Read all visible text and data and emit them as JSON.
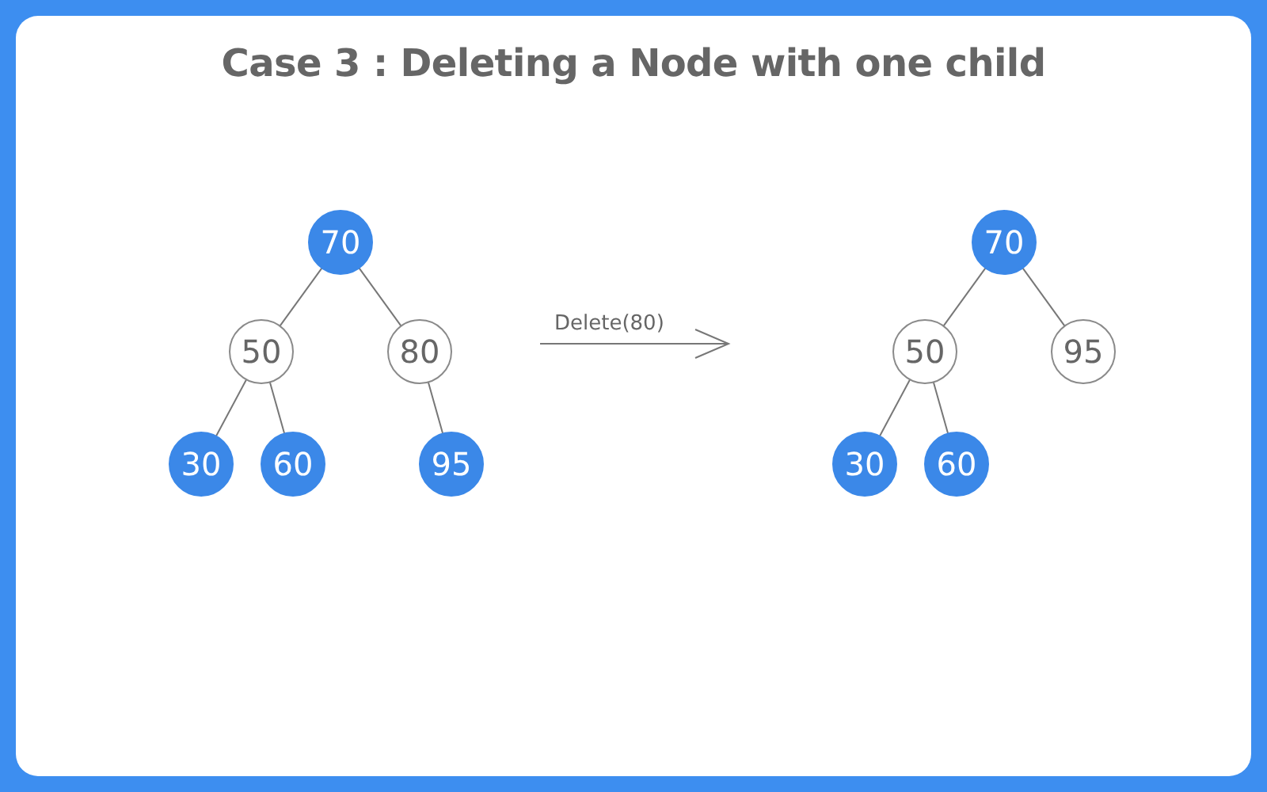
{
  "title": "Case 3 : Deleting a Node with one child",
  "trees": [
    {
      "root": {
        "value": "70",
        "kind": "filled",
        "children": [
          {
            "value": "50",
            "kind": "outline",
            "right": false,
            "children": [
              {
                "value": "30",
                "kind": "filled",
                "right": false
              },
              {
                "value": "60",
                "kind": "filled",
                "right": true
              }
            ]
          },
          {
            "value": "80",
            "kind": "outline",
            "right": true,
            "children": [
              {
                "value": "95",
                "kind": "filled",
                "right": true
              }
            ]
          }
        ]
      }
    },
    {
      "root": {
        "value": "70",
        "kind": "filled",
        "children": [
          {
            "value": "50",
            "kind": "outline",
            "right": false,
            "children": [
              {
                "value": "30",
                "kind": "filled",
                "right": false
              },
              {
                "value": "60",
                "kind": "filled",
                "right": true
              }
            ]
          },
          {
            "value": "95",
            "kind": "outline",
            "right": true
          }
        ]
      }
    }
  ],
  "arrow": {
    "label": "Delete(80)"
  }
}
